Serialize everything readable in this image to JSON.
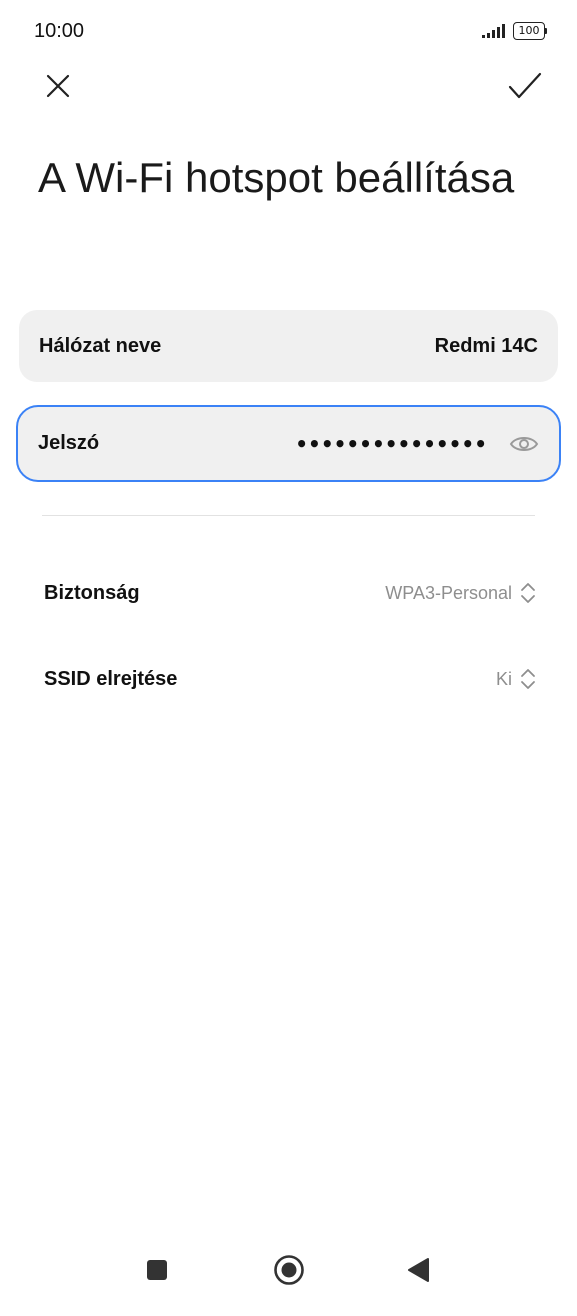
{
  "status_bar": {
    "time": "10:00",
    "battery": "100"
  },
  "header": {
    "title": "A Wi-Fi hotspot beállítása"
  },
  "fields": {
    "network_name": {
      "label": "Hálózat neve",
      "value": "Redmi 14C"
    },
    "password": {
      "label": "Jelszó",
      "masked_value": "•••••••••••••••"
    }
  },
  "settings": {
    "security": {
      "label": "Biztonság",
      "value": "WPA3-Personal"
    },
    "hide_ssid": {
      "label": "SSID elrejtése",
      "value": "Ki"
    }
  },
  "colors": {
    "accent": "#3b82f6",
    "field_bg": "#f0f0f0",
    "muted_text": "#8e8e8e"
  },
  "icons": {
    "close": "close-icon",
    "confirm": "check-icon",
    "show_password": "eye-icon",
    "selector": "chevron-up-down-icon",
    "nav_recents": "square-icon",
    "nav_home": "circle-icon",
    "nav_back": "triangle-back-icon"
  }
}
